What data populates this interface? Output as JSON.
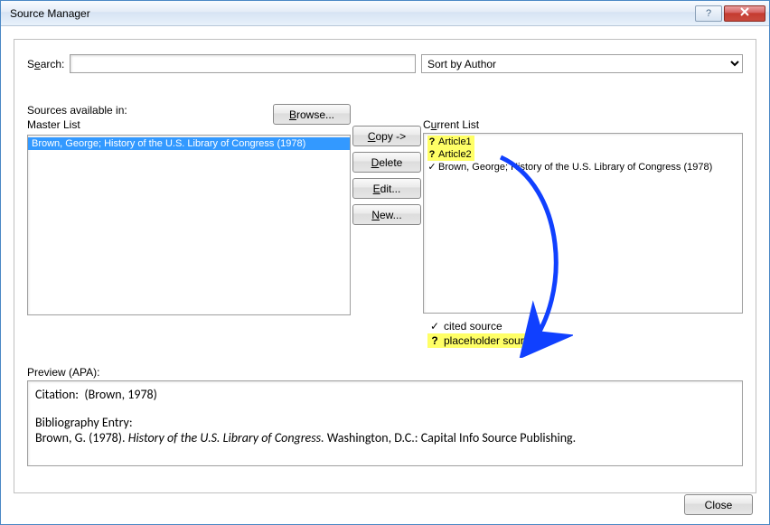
{
  "window": {
    "title": "Source Manager",
    "help_tooltip": "?",
    "close_tooltip": "Close"
  },
  "search": {
    "label_pre": "S",
    "label_underline": "e",
    "label_post": "arch:",
    "value": ""
  },
  "sort": {
    "selected": "Sort by Author"
  },
  "left": {
    "sources_available": "Sources available in:",
    "master_list": "Master List",
    "browse_pre": "",
    "browse_underline": "B",
    "browse_post": "rowse...",
    "items": [
      {
        "text": "Brown, George; History of the U.S. Library of Congress (1978)",
        "selected": true
      }
    ]
  },
  "mid": {
    "copy_underline": "C",
    "copy_post": "opy ->",
    "delete_underline": "D",
    "delete_post": "elete",
    "edit_underline": "E",
    "edit_post": "dit...",
    "new_underline": "N",
    "new_post": "ew..."
  },
  "right": {
    "current_list_pre": "C",
    "current_list_underline": "u",
    "current_list_post": "rrent List",
    "items": [
      {
        "mark": "?",
        "text": "Article1",
        "highlight": true
      },
      {
        "mark": "?",
        "text": "Article2",
        "highlight": true
      },
      {
        "mark": "✓",
        "text": "Brown, George; History of the U.S. Library of Congress (1978)",
        "highlight": false
      }
    ]
  },
  "legend": {
    "cited_mark": "✓",
    "cited_text": "cited source",
    "placeholder_mark": "?",
    "placeholder_text": "placeholder source"
  },
  "preview": {
    "label": "Preview (APA):",
    "citation_label": "Citation:",
    "citation_value": "(Brown, 1978)",
    "entry_label": "Bibliography Entry:",
    "entry_prefix": "Brown, G. (1978). ",
    "entry_title_italic": "History of the U.S. Library of Congress.",
    "entry_suffix": " Washington, D.C.: Capital Info Source Publishing."
  },
  "footer": {
    "close": "Close"
  }
}
